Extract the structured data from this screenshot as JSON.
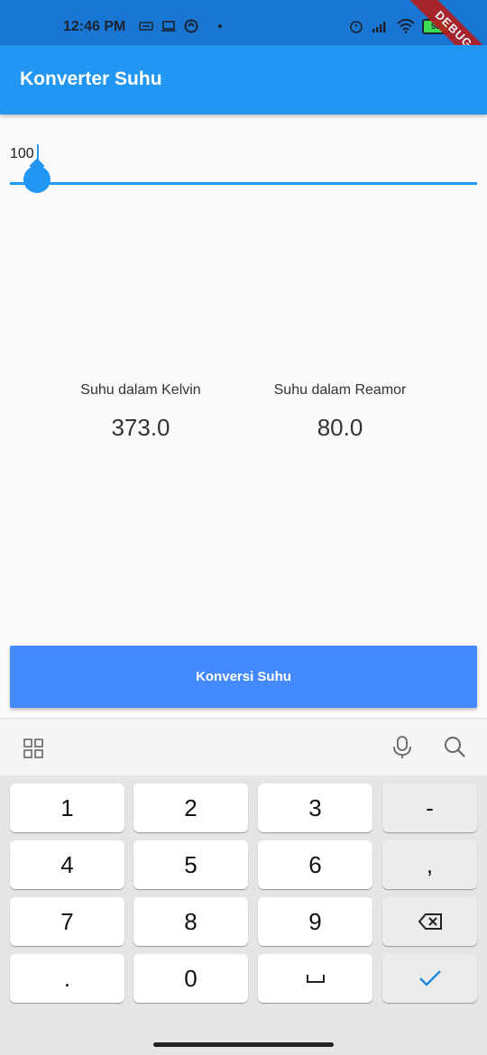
{
  "status_bar": {
    "time": "12:46 PM",
    "battery": "56",
    "debug_label": "DEBUG"
  },
  "app_bar": {
    "title": "Konverter Suhu"
  },
  "input": {
    "value": "100"
  },
  "slider": {
    "value_fraction": 0.04
  },
  "results": {
    "kelvin": {
      "label": "Suhu dalam Kelvin",
      "value": "373.0"
    },
    "reamor": {
      "label": "Suhu dalam Reamor",
      "value": "80.0"
    }
  },
  "convert_button": {
    "label": "Konversi Suhu"
  },
  "keyboard": {
    "rows": [
      [
        "1",
        "2",
        "3",
        "-"
      ],
      [
        "4",
        "5",
        "6",
        ","
      ],
      [
        "7",
        "8",
        "9",
        "⌫"
      ],
      [
        ".",
        "0",
        "␣",
        "✓"
      ]
    ]
  },
  "colors": {
    "status_bar": "#1976d2",
    "app_bar": "#2196f3",
    "button": "#448aff",
    "accent": "#2196f3"
  }
}
